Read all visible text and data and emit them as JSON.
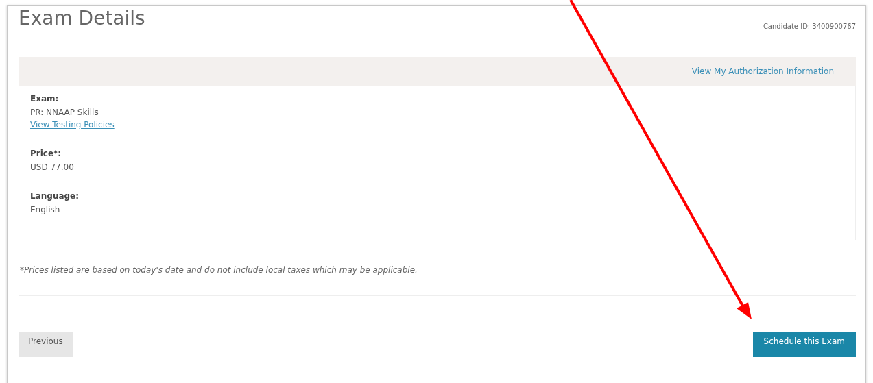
{
  "title": "Exam Details",
  "candidate_id": "Candidate ID: 3400900767",
  "authorization_link": "View My Authorization Information",
  "details": [
    {
      "label": "Exam:",
      "value": "PR: NNAAP Skills",
      "link": "View Testing Policies"
    },
    {
      "label": "Price*:",
      "value": "USD 77.00"
    },
    {
      "label": "Language:",
      "value": "English"
    }
  ],
  "footnote": "*Prices listed are based on today's date and do not include local taxes which may be applicable.",
  "buttons": [
    {
      "label": "Previous",
      "kind": "secondary"
    },
    {
      "label": "Schedule this Exam",
      "kind": "primary"
    }
  ]
}
